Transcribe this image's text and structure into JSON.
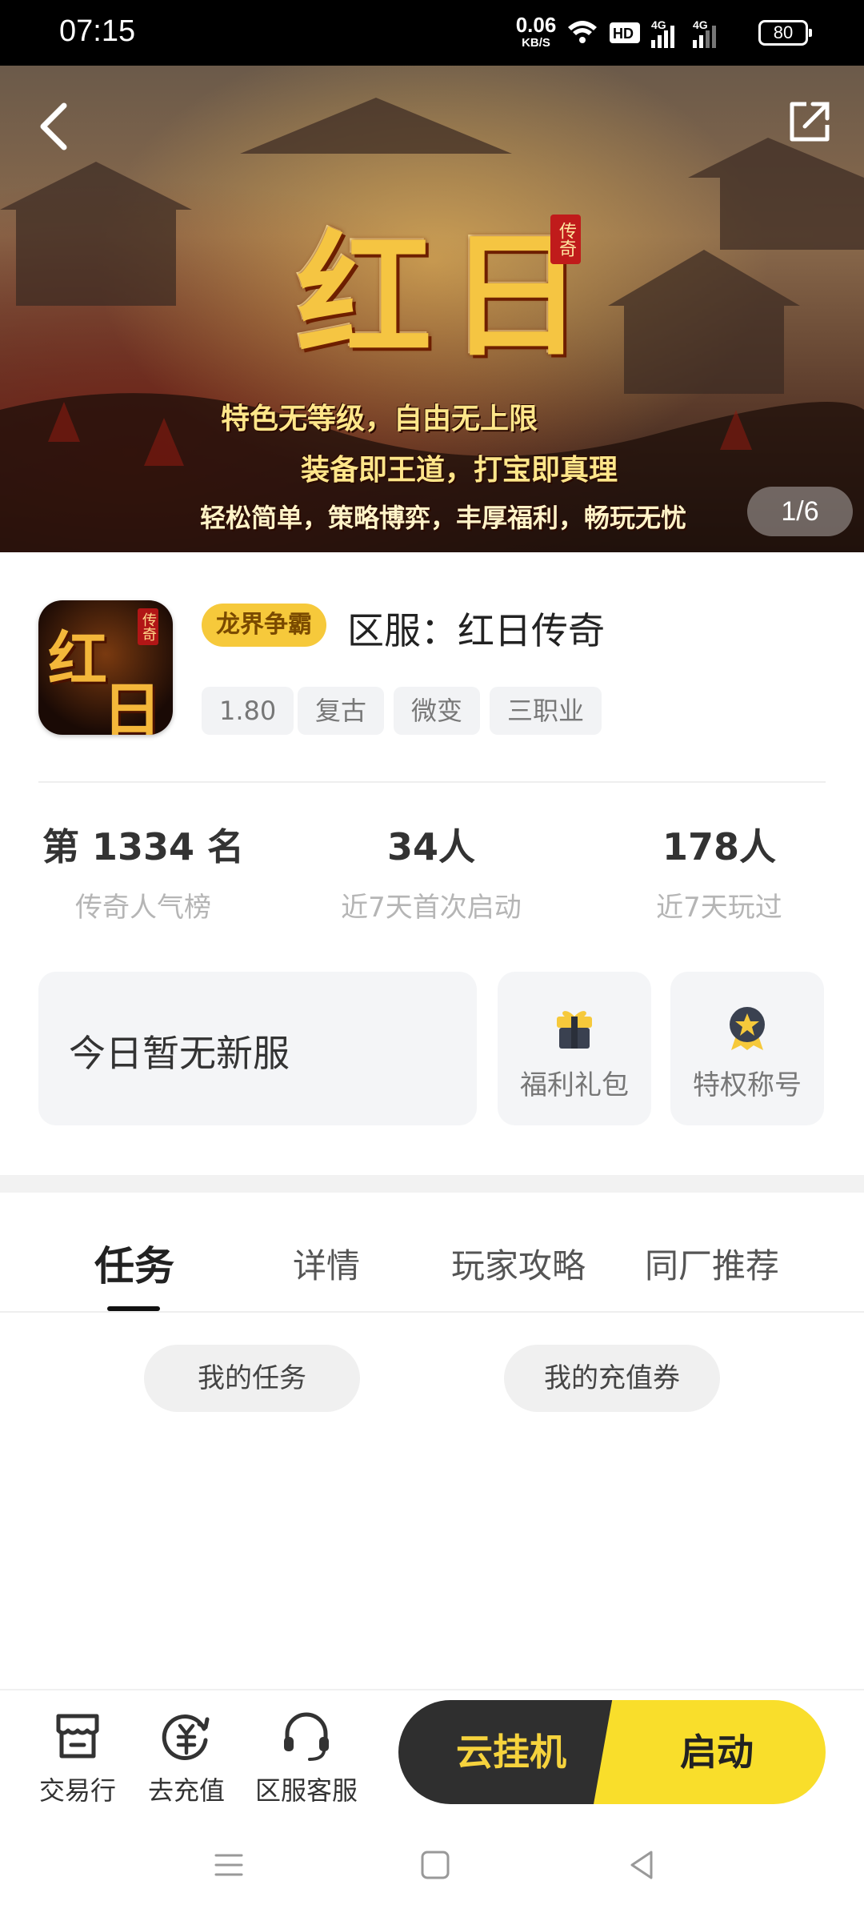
{
  "status_bar": {
    "time": "07:15",
    "net_speed_value": "0.06",
    "net_speed_unit": "KB/S",
    "battery": "80"
  },
  "banner": {
    "title": "红日",
    "badge": "传奇",
    "slogans": [
      "特色无等级，自由无上限",
      "装备即王道，打宝即真理",
      "轻松简单，策略博弈，丰厚福利，畅玩无忧"
    ],
    "page_indicator": "1/6"
  },
  "game": {
    "icon_text": [
      "红",
      "日"
    ],
    "icon_badge": "传奇",
    "server_tag": "龙界争霸",
    "server_title": "区服：红日传奇",
    "tags": [
      "1.80",
      "复古",
      "微变",
      "三职业"
    ]
  },
  "stats": [
    {
      "value": "第 1334 名",
      "label": "传奇人气榜"
    },
    {
      "value": "34人",
      "label": "近7天首次启动"
    },
    {
      "value": "178人",
      "label": "近7天玩过"
    }
  ],
  "cards": {
    "new_server": "今日暂无新服",
    "gift": "福利礼包",
    "title_privilege": "特权称号"
  },
  "tabs": [
    "任务",
    "详情",
    "玩家攻略",
    "同厂推荐"
  ],
  "task_pills": [
    "我的任务",
    "我的充值券"
  ],
  "bottom_nav": {
    "market": "交易行",
    "recharge": "去充值",
    "support": "区服客服",
    "cloud_btn": "云挂机",
    "start_btn": "启动"
  },
  "colors": {
    "accent_yellow": "#f9de2b",
    "server_tag_bg": "#f6c93b",
    "dark_button": "#2f2f2f"
  }
}
